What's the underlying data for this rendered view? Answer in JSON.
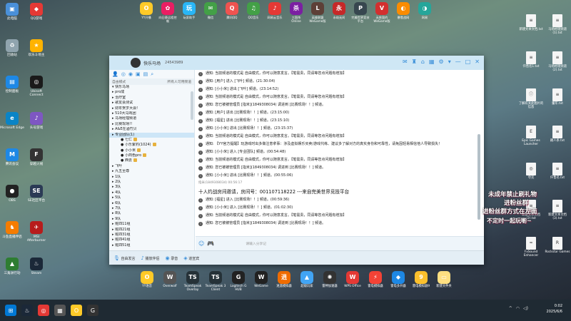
{
  "desktop_left": [
    {
      "label": "此电脑",
      "color": "#4a90d9",
      "glyph": "▣"
    },
    {
      "label": "QQ游戏",
      "color": "#e53935",
      "glyph": "◆"
    },
    {
      "label": "回收站",
      "color": "#90a4ae",
      "glyph": "♻"
    },
    {
      "label": "欢乐斗地主",
      "color": "#ffb300",
      "glyph": "★"
    },
    {
      "label": "控制面板",
      "color": "#1e88e5",
      "glyph": "▤"
    },
    {
      "label": "Ubisoft Connect",
      "color": "#1a1a1a",
      "glyph": "◎"
    },
    {
      "label": "Microsoft Edge",
      "color": "#0a84c6",
      "glyph": "e"
    },
    {
      "label": "头号游戏",
      "color": "#7e57c2",
      "glyph": "♪"
    },
    {
      "label": "腾讯会议",
      "color": "#1e88e5",
      "glyph": "M"
    },
    {
      "label": "穿越火线",
      "color": "#333",
      "glyph": "F"
    },
    {
      "label": "OBS",
      "color": "#222",
      "glyph": "●"
    },
    {
      "label": "SE社区平台",
      "color": "#2b3a55",
      "glyph": "SE"
    },
    {
      "label": "斗鱼直播伴侣",
      "color": "#f57c00",
      "glyph": "♞"
    },
    {
      "label": "MSI Afterburner",
      "color": "#b71c1c",
      "glyph": "✈"
    },
    {
      "label": "三角洲行动",
      "color": "#2e7d32",
      "glyph": "▲"
    },
    {
      "label": "Steam",
      "color": "#1b2838",
      "glyph": "♨"
    }
  ],
  "top_icons": [
    {
      "label": "YY开播",
      "color": "#ffca28",
      "glyph": "O"
    },
    {
      "label": "向日葵远程控制",
      "color": "#e91e63",
      "glyph": "✿"
    },
    {
      "label": "玩家助手",
      "color": "#29b6f6",
      "glyph": "玩"
    },
    {
      "label": "微信",
      "color": "#43a047",
      "glyph": "✉"
    },
    {
      "label": "腾讯QQ",
      "color": "#ef5350",
      "glyph": "Q"
    },
    {
      "label": "QQ音乐",
      "color": "#43a047",
      "glyph": "♫"
    },
    {
      "label": "网易云音乐",
      "color": "#e53935",
      "glyph": "♪"
    },
    {
      "label": "三国杀Online",
      "color": "#7b1fa2",
      "glyph": "杀"
    },
    {
      "label": "英雄联盟WeGame版",
      "color": "#5d4037",
      "glyph": "L"
    },
    {
      "label": "永劫无间",
      "color": "#c62828",
      "glyph": "永"
    },
    {
      "label": "完美世界竞技平台",
      "color": "#37474f",
      "glyph": "P"
    },
    {
      "label": "无畏契约 WeGame版",
      "color": "#d32f2f",
      "glyph": "V"
    },
    {
      "label": "暴雪战网",
      "color": "#fb8c00",
      "glyph": "◐"
    },
    {
      "label": "网易",
      "color": "#26a69a",
      "glyph": "◑"
    }
  ],
  "bottom_icons": [
    {
      "label": "YY语音",
      "color": "#ffca28",
      "glyph": "O"
    },
    {
      "label": "Overwolf",
      "color": "#555",
      "glyph": "W"
    },
    {
      "label": "TeamSpeak Overlay",
      "color": "#263238",
      "glyph": "TS"
    },
    {
      "label": "TeamSpeak 3 Client",
      "color": "#263238",
      "glyph": "TS"
    },
    {
      "label": "Logitech G HUB",
      "color": "#222",
      "glyph": "G"
    },
    {
      "label": "WeGame",
      "color": "#222",
      "glyph": "W"
    },
    {
      "label": "逍遥模拟器",
      "color": "#ef6c00",
      "glyph": "逍"
    },
    {
      "label": "超级玩家",
      "color": "#42a5f5",
      "glyph": "▲"
    },
    {
      "label": "雷神加速器",
      "color": "#333",
      "glyph": "✺"
    },
    {
      "label": "WPS Office",
      "color": "#e53935",
      "glyph": "W"
    },
    {
      "label": "雷电模拟器",
      "color": "#f44336",
      "glyph": "⚡"
    },
    {
      "label": "雷电多开器",
      "color": "#1e88e5",
      "glyph": "◆"
    },
    {
      "label": "雷电模拟器9",
      "color": "#fbc02d",
      "glyph": "9"
    },
    {
      "label": "新建文件夹",
      "color": "#ffe082",
      "glyph": "▭"
    }
  ],
  "desktop_right": [
    {
      "label": "新建文本文档.txt",
      "glyph": "≡"
    },
    {
      "label": "马场经理频道(1).txt",
      "glyph": "≡"
    },
    {
      "label": "仟售名1.txt",
      "glyph": "≡"
    },
    {
      "label": "马场经理频道(2).txt",
      "glyph": "≡"
    },
    {
      "label": "了解有关此图片的信息",
      "glyph": "ⓘ"
    },
    {
      "label": "董年.txt",
      "glyph": "≡"
    },
    {
      "label": "Epic Games Launcher",
      "glyph": "E"
    },
    {
      "label": "踢人条.txt",
      "glyph": "≡"
    },
    {
      "label": "夸克",
      "glyph": "◎"
    },
    {
      "label": "仟售名.txt",
      "glyph": "≡"
    },
    {
      "label": "新建文本文档(2).txt",
      "glyph": "≡"
    },
    {
      "label": "新建文本文档(3).txt",
      "glyph": "≡"
    },
    {
      "label": "FxSound Enhancer",
      "glyph": "≈"
    },
    {
      "label": "Rockstar Games",
      "glyph": "R"
    }
  ],
  "window": {
    "title": "快乐马场",
    "id": "24543989",
    "top_icons": [
      "✉",
      "♜",
      "⌂",
      "▦",
      "⚙",
      "▾",
      "—",
      "□",
      "✕"
    ]
  },
  "sidebar": {
    "tools": [
      "👤",
      "◎",
      "◉",
      "▣",
      "▤",
      "⌕"
    ],
    "header_left": "自由模式",
    "header_right": "所有人可用频道",
    "channels": [
      {
        "label": "快乐马场",
        "kind": "root",
        "sel": false
      },
      {
        "label": "pro成",
        "kind": "item",
        "sel": false
      },
      {
        "label": "治疗室",
        "kind": "item",
        "sel": false
      },
      {
        "label": "歌友会测试",
        "kind": "item",
        "sel": false
      },
      {
        "label": "财年贺岁大会!",
        "kind": "item",
        "sel": false
      },
      {
        "label": "510大马戏团",
        "kind": "item",
        "sel": false
      },
      {
        "label": "马场经理频道",
        "kind": "item",
        "sel": false
      },
      {
        "label": "比赛现场!!",
        "kind": "item",
        "sel": false
      },
      {
        "label": "A&E在酒竹贝",
        "kind": "item",
        "sel": false
      },
      {
        "label": "专业团队(1)",
        "kind": "item",
        "sel": true
      },
      {
        "label": "七仁",
        "kind": "user",
        "sel": false
      },
      {
        "label": "小乐紫钓(1024)",
        "kind": "user",
        "sel": false
      },
      {
        "label": "小小米",
        "kind": "user",
        "sel": false
      },
      {
        "label": "小商色pro",
        "kind": "user",
        "sel": false
      },
      {
        "label": "西去",
        "kind": "user",
        "sel": false
      },
      {
        "label": "飞叶",
        "kind": "item",
        "sel": false
      },
      {
        "label": "九五至尊",
        "kind": "item",
        "sel": false
      },
      {
        "label": "1队",
        "kind": "item",
        "sel": false
      },
      {
        "label": "2队",
        "kind": "item",
        "sel": false
      },
      {
        "label": "3队",
        "kind": "item",
        "sel": false
      },
      {
        "label": "4队",
        "kind": "item",
        "sel": false
      },
      {
        "label": "5队",
        "kind": "item",
        "sel": false
      },
      {
        "label": "6队",
        "kind": "item",
        "sel": false
      },
      {
        "label": "7队",
        "kind": "item",
        "sel": false
      },
      {
        "label": "8队",
        "kind": "item",
        "sel": false
      },
      {
        "label": "9队",
        "kind": "item",
        "sel": false
      },
      {
        "label": "赃四11组",
        "kind": "item",
        "sel": false
      },
      {
        "label": "赃四21组",
        "kind": "item",
        "sel": false
      },
      {
        "label": "赃四31组",
        "kind": "item",
        "sel": false
      },
      {
        "label": "赃四41组",
        "kind": "item",
        "sel": false
      },
      {
        "label": "赃四51组",
        "kind": "item",
        "sel": false
      }
    ]
  },
  "messages": [
    {
      "text": "通知: 当前频道的模式是 自由模式，你可以随意发言。【笔需贵，同请等您点问题有增加】",
      "style": ""
    },
    {
      "text": "通知: [用户] 进入 [飞叶] 频道。(21:30:04)",
      "style": ""
    },
    {
      "text": "通知: [小小米] 进出 [飞叶] 频道。(23:14:52)",
      "style": ""
    },
    {
      "text": "通知: 当前频道的模式是 自由模式，你可以随意发言。【笔需贵，同请等您点问题有增加】",
      "style": ""
    },
    {
      "text": "通知: 您已被被管理员 [指米](1849308034) 调进到 [比赛现场！！] 频道。",
      "style": ""
    },
    {
      "text": "通知: [用户] 进出 [比赛现场！！] 频道。(23:15:00)",
      "style": ""
    },
    {
      "text": "通知: [福星] 进出 [比赛现场！！] 频道。(23:15:10)",
      "style": ""
    },
    {
      "text": "通知: [小小米] 进出 [比赛现场！！] 频道。(23:15:37)",
      "style": ""
    },
    {
      "text": "通知: 当前频道的模式是 自由模式，你可以随意发言。【笔需贵，同请等您点问题有增加】",
      "style": ""
    },
    {
      "text": "通知: 【YY官方提醒】玩游戏时出多做注意拿事：涉及虚拟娱乐买卖/游戏代练、建议多了解对方的真实身份和可靠性，请免因轻易相信他人导致损失！",
      "style": ""
    },
    {
      "text": "通知: [小小米] 进入 [专业团队] 频道。(00:54:48)",
      "style": ""
    },
    {
      "text": "通知: 当前频道的模式是 自由模式，你可以随意发言。【笔需贵，同请等您点问题有增加】",
      "style": ""
    },
    {
      "text": "通知: 您已被被管理员 [指米](1849308034) 调进到 [比赛现场！！] 频道。",
      "style": ""
    },
    {
      "text": "通知: [小小米] 进出 [比赛现场！！] 频道。(00:55:06)",
      "style": ""
    },
    {
      "text": "指米(1849308034)  00:56:17",
      "style": "small"
    },
    {
      "text": "十人约战房间邀请，房间号：001107118222 ---来自完美世界竞技平台",
      "style": "big"
    },
    {
      "text": "通知: [福星] 进入 [比赛现场！！] 频道。(00:59:36)",
      "style": ""
    },
    {
      "text": "通知: [小小米] 进入 [比赛现场！！] 频道。(01:02:30)",
      "style": ""
    },
    {
      "text": "通知: 当前频道的模式是 自由模式，你可以随意发言。【笔需贵，同请等您点问题有增加】",
      "style": ""
    },
    {
      "text": "通知: 您已被被管理员 [指米](1849308034) 调进到 [比赛现场！！] 频道。",
      "style": ""
    }
  ],
  "input": {
    "placeholder": "请输入分享记"
  },
  "statusbar": {
    "items": [
      "自由发言",
      "播放伴侣",
      "录音",
      "道宣宾"
    ]
  },
  "overlay": {
    "l1": "未成年禁止刷礼物",
    "l2": "进粉丝群",
    "l3": "进粉丝群方式在左面",
    "l4": "不定时一起玩喲~"
  },
  "taskbar": {
    "icons": [
      {
        "glyph": "⊞",
        "color": "#0078d4"
      },
      {
        "glyph": "♨",
        "color": "#1b2838"
      },
      {
        "glyph": "◎",
        "color": "#e53935"
      },
      {
        "glyph": "▦",
        "color": "#555"
      },
      {
        "glyph": "O",
        "color": "#ffca28"
      },
      {
        "glyph": "G",
        "color": "#333"
      }
    ],
    "time": "0:02",
    "date": "2025/6/6"
  }
}
